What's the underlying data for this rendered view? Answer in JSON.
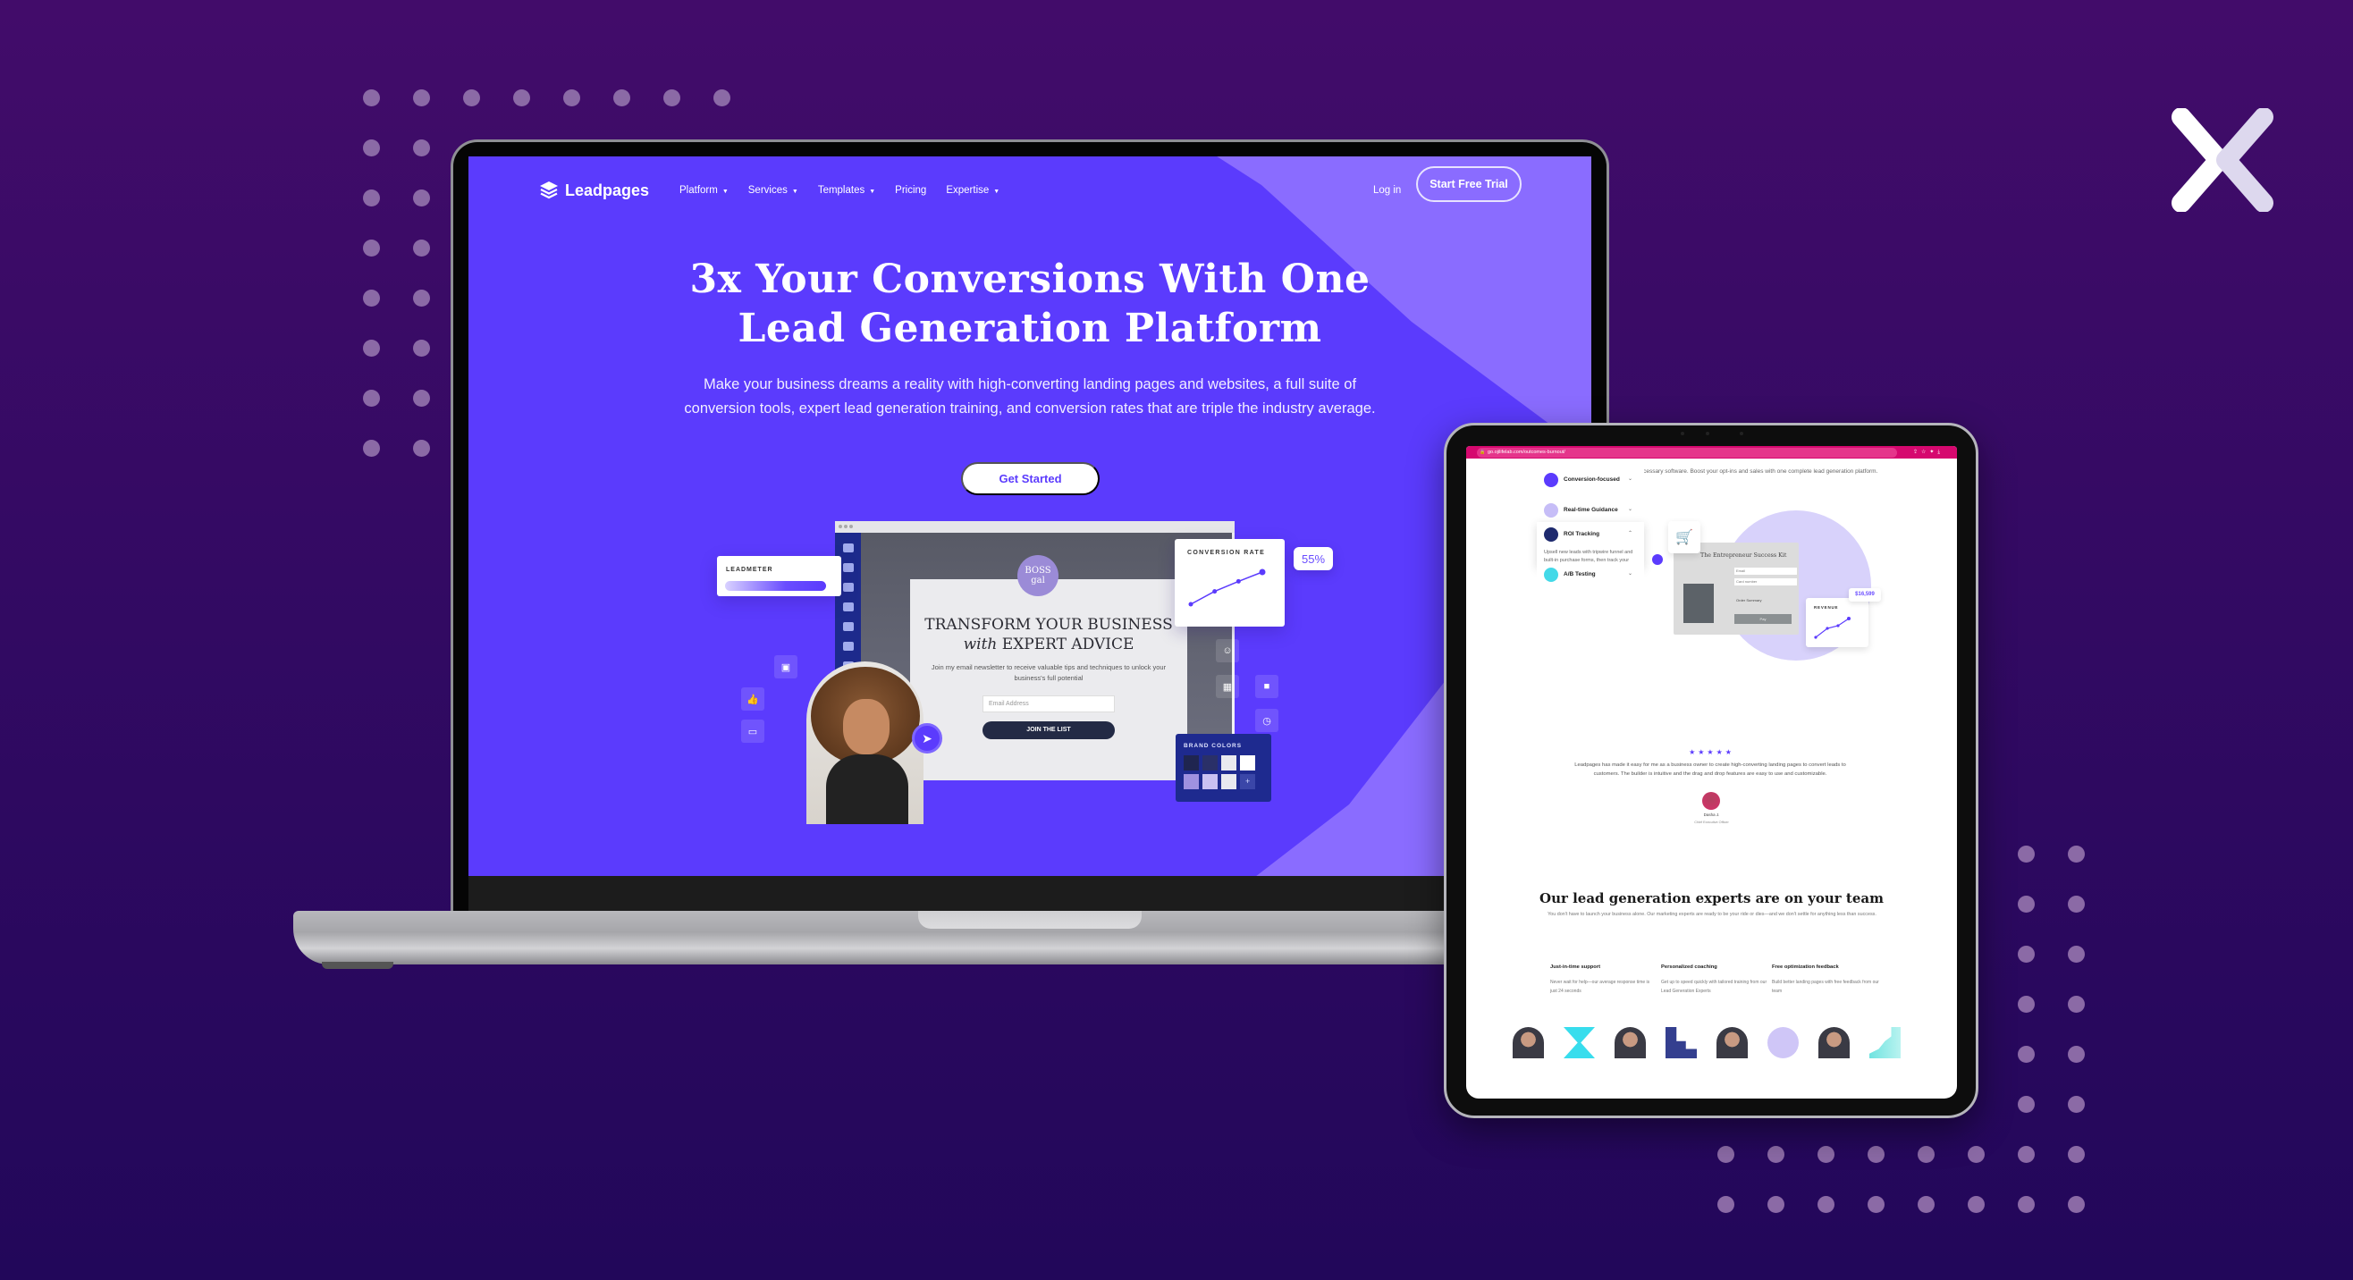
{
  "brand": {
    "logo_icon": "x-chevrons-logo-icon",
    "colors": {
      "background_top": "#420c6a",
      "background_bottom": "#22075a",
      "dot": "#8b6aa6",
      "accent": "#5b3bfd",
      "accent_light": "#8a6cff",
      "tablet_browser_bar": "#d6086f"
    }
  },
  "laptop": {
    "nav": {
      "logo_text": "Leadpages",
      "links": [
        {
          "label": "Platform",
          "has_dropdown": true
        },
        {
          "label": "Services",
          "has_dropdown": true
        },
        {
          "label": "Templates",
          "has_dropdown": true
        },
        {
          "label": "Pricing",
          "has_dropdown": false
        },
        {
          "label": "Expertise",
          "has_dropdown": true
        }
      ],
      "login_label": "Log in",
      "cta_label": "Start Free Trial"
    },
    "hero": {
      "title_line1": "3x Your Conversions With One",
      "title_line2": "Lead Generation Platform",
      "subtitle": "Make your business dreams a reality with high-converting landing pages and websites, a full suite of conversion tools, expert lead generation training, and conversion rates that are triple the industry average.",
      "cta_label": "Get Started"
    },
    "mockup": {
      "badge_text": "BOSS gal",
      "headline_line1": "TRANSFORM YOUR BUSINESS",
      "headline_em": "with",
      "headline_line2": "EXPERT ADVICE",
      "body": "Join my email newsletter to receive valuable tips and techniques to unlock your business's full potential",
      "email_placeholder": "Email Address",
      "button_label": "JOIN THE LIST",
      "leadmeter_label": "LEADMETER",
      "leadmeter_level": 0.75,
      "conversion_label": "CONVERSION RATE",
      "conversion_value": "55%",
      "conversion_points": [
        10,
        28,
        42,
        55
      ],
      "brand_colors_label": "BRAND COLORS",
      "brand_colors": [
        "#1f2550",
        "#2a3068",
        "#e9e9ef",
        "#ffffff",
        "#9f91e0",
        "#c9c1f2",
        "#e9e9ef"
      ],
      "add_color_label": "+"
    }
  },
  "tablet": {
    "url": "go.ojilifelab.com/outcomes-burnout/",
    "intro": "Ditch expensive consultants and unnecessary software. Boost your opt-ins and sales with one complete lead generation platform.",
    "accordion": [
      {
        "label": "Conversion-focused",
        "open": false,
        "color": "#5b3bfd"
      },
      {
        "label": "Real-time Guidance",
        "open": false,
        "color": "#c6bdf7"
      },
      {
        "label": "ROI Tracking",
        "open": true,
        "color": "#1e2a6e",
        "description": "Upsell new leads with tripwire funnel and built-in purchase forms, then track your ROI right from your dashboard."
      },
      {
        "label": "A/B Testing",
        "open": false,
        "color": "#43d9e8"
      }
    ],
    "product_card": {
      "title": "The Entrepreneur Success Kit",
      "email_field": "Email",
      "card_field": "Card number",
      "card_hint": "MM / YY",
      "order_summary": "Order Summary",
      "pay_label": "Pay",
      "revenue_label": "REVENUE",
      "revenue_value": "$16,599"
    },
    "testimonial": {
      "stars": 5,
      "quote": "Leadpages has made it easy for me as a business owner to create high-converting landing pages to convert leads to customers. The builder is intuitive and the drag and drop features are easy to use and customizable.",
      "name": "Dasha J.",
      "role": "Chief Executive Officer"
    },
    "experts": {
      "title": "Our lead generation experts are on your team",
      "subtitle": "You don't have to launch your business alone. Our marketing experts are ready to be your ride or dies—and we don't settle for anything less than success.",
      "features": [
        {
          "title": "Just-in-time support",
          "text": "Never wait for help—our average response time is just 24 seconds"
        },
        {
          "title": "Personalized coaching",
          "text": "Get up to speed quickly with tailored training from our Lead Generation Experts"
        },
        {
          "title": "Free optimization feedback",
          "text": "Build better landing pages with free feedback from our team"
        }
      ],
      "team_tiles": [
        "expert-photo",
        "hourglass-shape",
        "expert-photo",
        "step-shape",
        "expert-photo",
        "circle-shape",
        "expert-photo",
        "stairs-shape"
      ]
    }
  }
}
